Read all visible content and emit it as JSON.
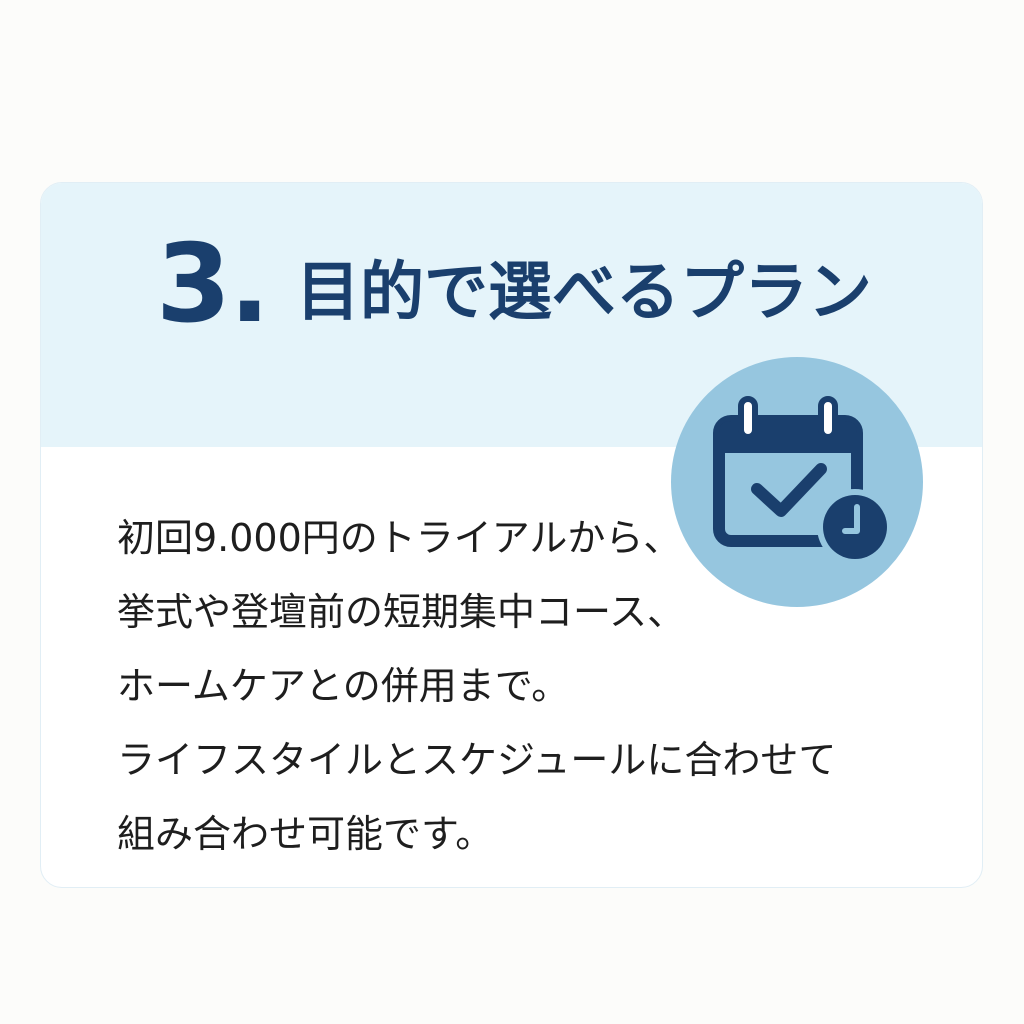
{
  "section": {
    "number": "3.",
    "title": "目的で選べるプラン"
  },
  "icon": {
    "name": "calendar-check-clock-icon",
    "badge_color": "#96c6df",
    "icon_color": "#1a3f6d"
  },
  "body": {
    "lines": [
      "初回9.000円のトライアルから、",
      "挙式や登壇前の短期集中コース、",
      "ホームケアとの併用まで。",
      "ライフスタイルとスケジュールに合わせて",
      "組み合わせ可能です。"
    ]
  },
  "colors": {
    "page_background": "#fcfcfa",
    "card_header": "#e5f4fa",
    "card_body": "#ffffff",
    "heading": "#1a3f6d",
    "text": "#1e1e1e"
  }
}
